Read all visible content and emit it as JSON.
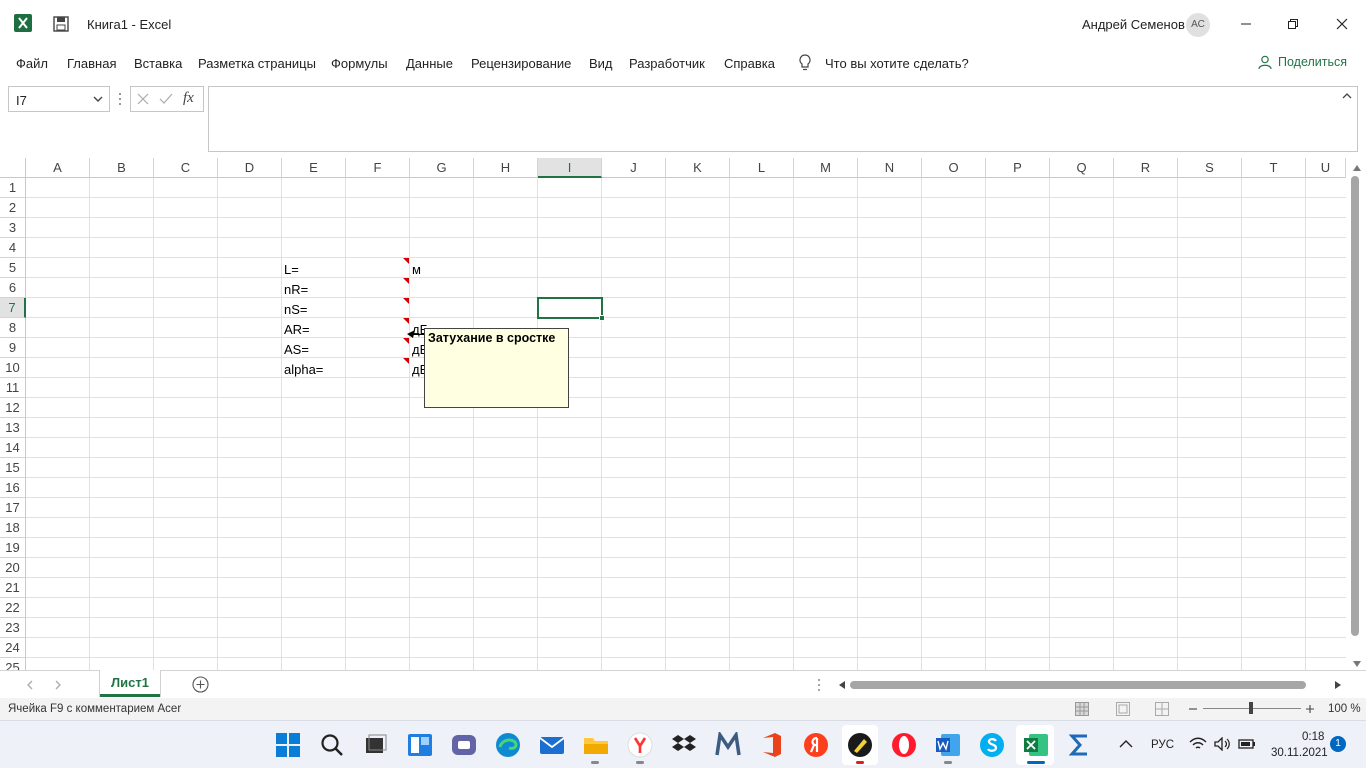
{
  "title_bar": {
    "doc_title": "Книга1  -  Excel",
    "user_name": "Андрей Семенов",
    "avatar_initials": "АС"
  },
  "ribbon": {
    "tabs": [
      "Файл",
      "Главная",
      "Вставка",
      "Разметка страницы",
      "Формулы",
      "Данные",
      "Рецензирование",
      "Вид",
      "Разработчик",
      "Справка"
    ],
    "tell_me": "Что вы хотите сделать?",
    "share": "Поделиться"
  },
  "formula_bar": {
    "name_box": "I7",
    "fx": "fx",
    "value": ""
  },
  "grid": {
    "columns": [
      "A",
      "B",
      "C",
      "D",
      "E",
      "F",
      "G",
      "H",
      "I",
      "J",
      "K",
      "L",
      "M",
      "N",
      "O",
      "P",
      "Q",
      "R",
      "S",
      "T",
      "U"
    ],
    "selected_column": "I",
    "rows": [
      "1",
      "2",
      "3",
      "4",
      "5",
      "6",
      "7",
      "8",
      "9",
      "10",
      "11",
      "12",
      "13",
      "14",
      "15",
      "16",
      "17",
      "18",
      "19",
      "20",
      "21",
      "22",
      "23",
      "24",
      "25"
    ],
    "selected_row": "7",
    "cells": {
      "E5": "L=",
      "E6": "nR=",
      "E7": "nS=",
      "E8": "AR=",
      "E9": "AS=",
      "E10": "alpha=",
      "G5": "м",
      "G8": "дБ",
      "G9": "дБ",
      "G10": "дБ"
    },
    "comment_text": "Затухание в сростке"
  },
  "sheets": {
    "active": "Лист1"
  },
  "status_bar": {
    "text": "Ячейка F9 с комментарием Acer",
    "zoom": "100 %"
  },
  "taskbar": {
    "language": "РУС",
    "time": "0:18",
    "date": "30.11.2021",
    "notifications": "1"
  },
  "colors": {
    "accent": "#217346",
    "comment_bg": "#ffffe1",
    "comment_marker": "#d00000"
  }
}
